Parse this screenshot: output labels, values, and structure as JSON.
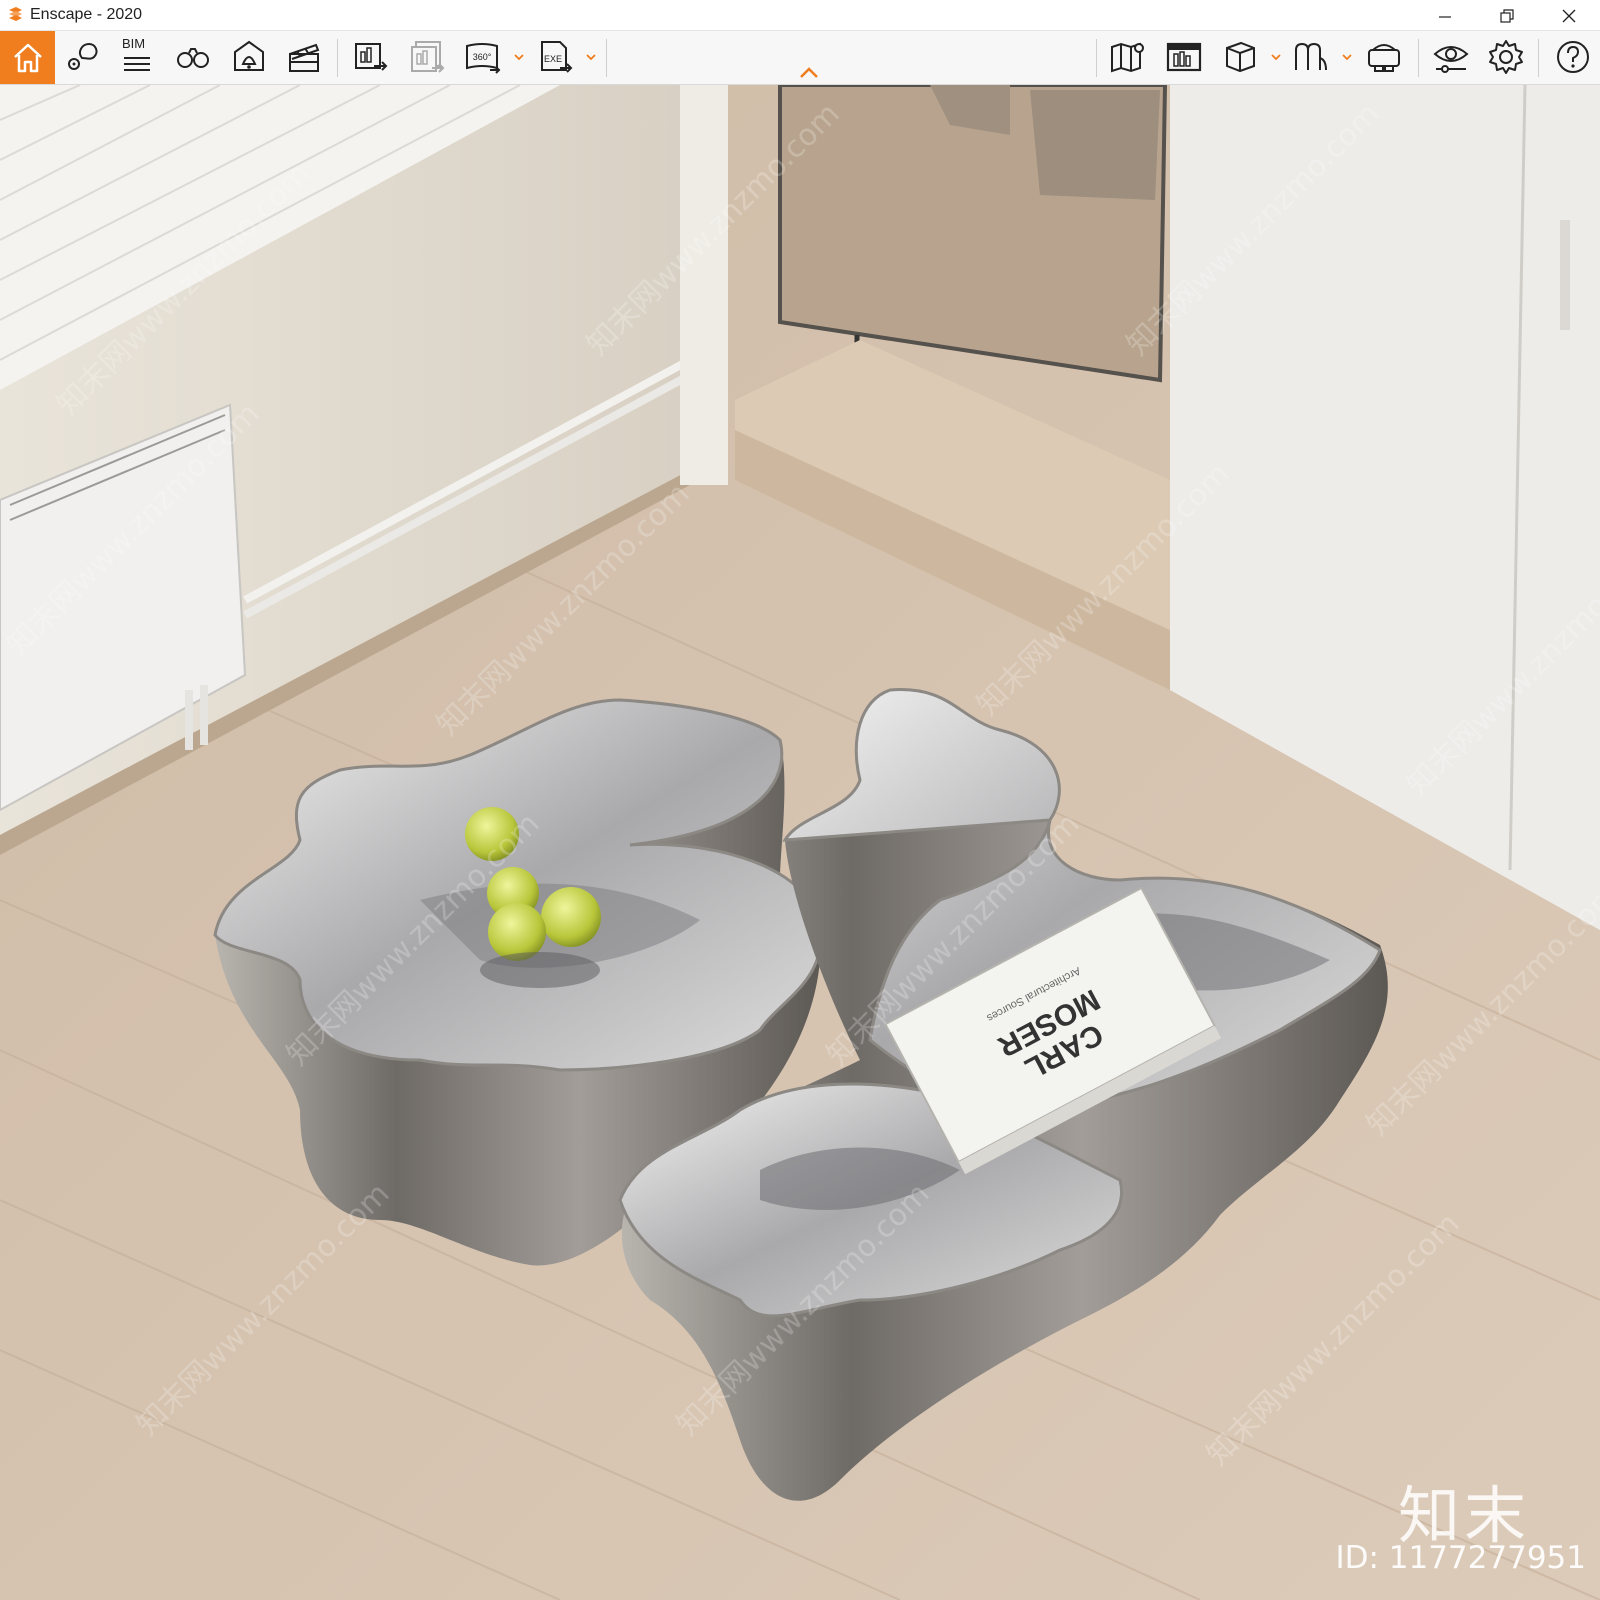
{
  "window": {
    "title": "Enscape - 2020",
    "controls": [
      "minimize",
      "restore",
      "close"
    ]
  },
  "toolbar": {
    "left_group": [
      {
        "name": "home",
        "icon": "home-icon",
        "active": true
      },
      {
        "name": "bim-marker",
        "icon": "map-pin-icon"
      },
      {
        "name": "bim",
        "icon": "bim-list-icon",
        "label": "BIM"
      },
      {
        "name": "binoculars",
        "icon": "binoculars-icon"
      },
      {
        "name": "sun-position",
        "icon": "sun-bell-icon"
      },
      {
        "name": "video-editor",
        "icon": "clapperboard-icon"
      },
      {
        "name": "export-screenshot",
        "icon": "export-image-icon"
      },
      {
        "name": "batch-render",
        "icon": "batch-render-icon"
      },
      {
        "name": "export-panorama",
        "icon": "panorama-icon",
        "label": "360°"
      },
      {
        "name": "export-exe",
        "icon": "exe-export-icon",
        "label": "EXE"
      }
    ],
    "right_group": [
      {
        "name": "map",
        "icon": "map-icon"
      },
      {
        "name": "gallery",
        "icon": "gallery-icon"
      },
      {
        "name": "box-view",
        "icon": "cube-icon"
      },
      {
        "name": "asset-library",
        "icon": "asset-library-icon"
      },
      {
        "name": "vr-headset",
        "icon": "vr-headset-icon"
      },
      {
        "name": "visual-settings",
        "icon": "eye-settings-icon"
      },
      {
        "name": "settings",
        "icon": "gear-icon"
      },
      {
        "name": "help",
        "icon": "help-icon"
      }
    ],
    "accent_color": "#f07d1e"
  },
  "scene": {
    "book_title_line1": "CARL",
    "book_title_line2": "MOSER",
    "book_subtitle": "Architectural Sources"
  },
  "watermark": {
    "text": "知末网www.znzmo.com",
    "brand": "知末",
    "id": "ID: 1177277951"
  }
}
